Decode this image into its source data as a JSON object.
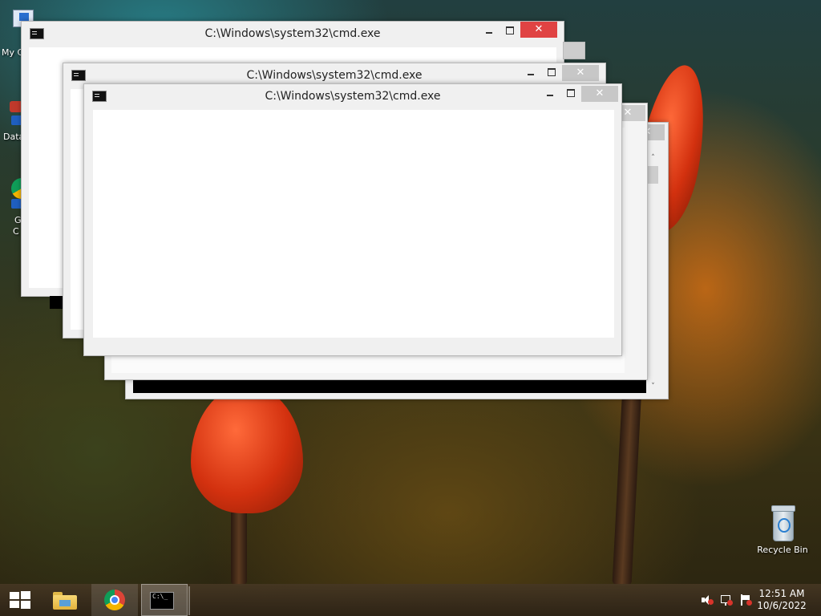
{
  "desktop": {
    "icons": [
      {
        "label": "My C"
      },
      {
        "label": "Data"
      },
      {
        "label": "G"
      },
      {
        "label": "C"
      },
      {
        "label": "Recycle Bin"
      }
    ]
  },
  "windows": [
    {
      "title": "C:\\Windows\\system32\\cmd.exe",
      "close": "✕"
    },
    {
      "title": "C:\\Windows\\system32\\cmd.exe",
      "close": "✕"
    },
    {
      "title": "C:\\Windows\\system32\\cmd.exe",
      "close": "✕"
    },
    {
      "title": "",
      "close": "✕"
    },
    {
      "title": "",
      "close": "✕"
    }
  ],
  "scrollbar": {
    "up": "˄",
    "down": "˅"
  },
  "taskbar": {
    "items": [
      "start",
      "file-explorer",
      "chrome",
      "command-prompt"
    ],
    "clock": {
      "time": "12:51 AM",
      "date": "10/6/2022"
    },
    "cmd_icon_text": "C:\\_"
  }
}
